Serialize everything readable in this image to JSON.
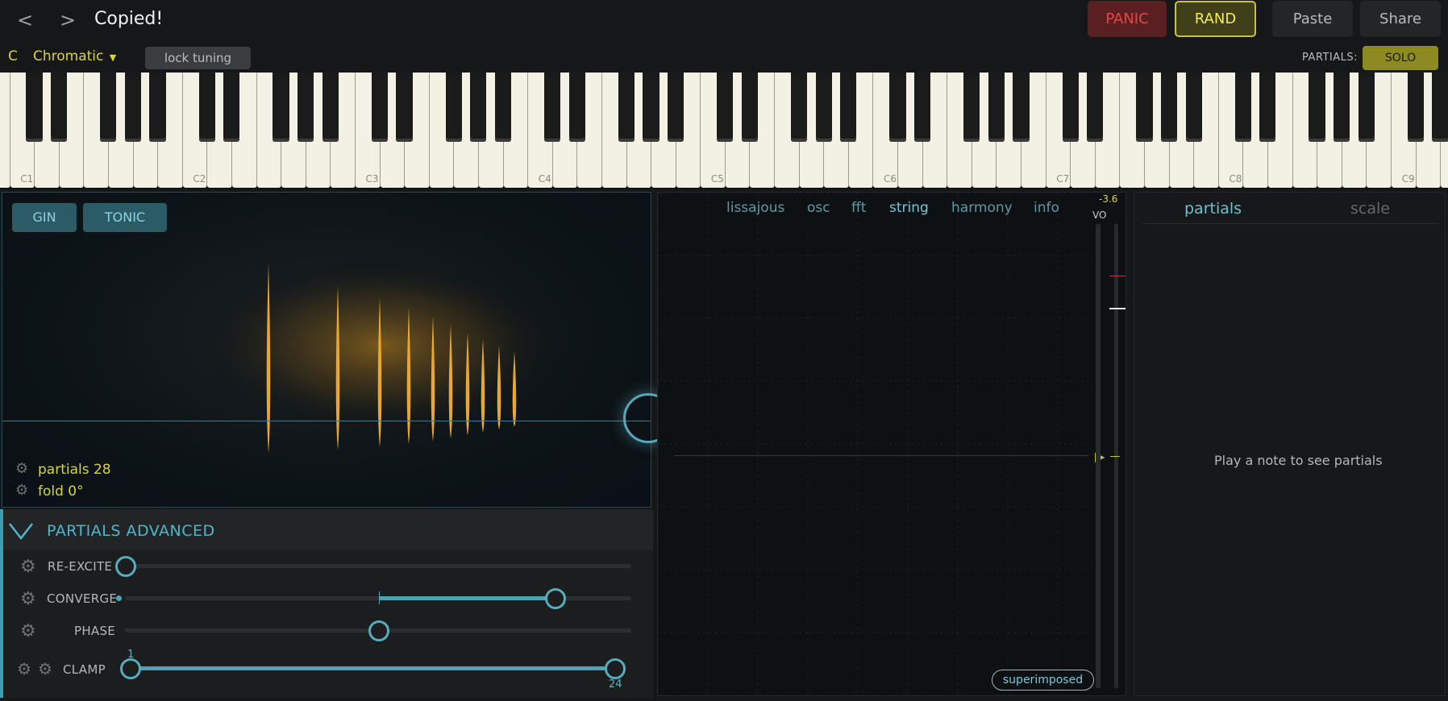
{
  "header": {
    "back_label": "<",
    "forward_label": ">",
    "title": "Copied!",
    "panic_label": "PANIC",
    "rand_label": "RAND",
    "paste_label": "Paste",
    "share_label": "Share"
  },
  "toolbar": {
    "key": "C",
    "scale": "Chromatic",
    "lock_label": "lock tuning",
    "partials_label": "PARTIALS:",
    "solo_label": "SOLO"
  },
  "keyboard": {
    "octave_labels": [
      "C1",
      "C2",
      "C3",
      "C4",
      "C5",
      "C6",
      "C7",
      "C8",
      "C9"
    ]
  },
  "visualizer": {
    "gin_label": "GIN",
    "tonic_label": "TONIC",
    "partials_text": "partials 28",
    "fold_text": "fold 0°",
    "partial_amplitudes": [
      1.0,
      0.86,
      0.78,
      0.72,
      0.66,
      0.61,
      0.56,
      0.52,
      0.48,
      0.44
    ],
    "colors": {
      "partial": "#e8a632",
      "glow": "#d19022"
    }
  },
  "advanced": {
    "title": "PARTIALS ADVANCED",
    "sliders": [
      {
        "label": "RE-EXCITE",
        "value": 0.0
      },
      {
        "label": "CONVERGE",
        "value": 0.85,
        "center": 0.5
      },
      {
        "label": "PHASE",
        "value": 0.5
      },
      {
        "label": "CLAMP",
        "min_text": "1",
        "max_text": "24",
        "low": 0.0,
        "high": 1.0
      }
    ]
  },
  "view_tabs": [
    "lissajous",
    "osc",
    "fft",
    "string",
    "harmony",
    "info"
  ],
  "active_view": "string",
  "meter": {
    "value_text": "-3.6",
    "vo_label": "VO"
  },
  "superimposed_label": "superimposed",
  "right_panel": {
    "tabs": [
      "partials",
      "scale"
    ],
    "empty_hint": "Play a note to see partials"
  },
  "accent_colors": {
    "teal": "#4cb8cc",
    "yellow": "#d9d43c",
    "red": "#e0484a"
  }
}
